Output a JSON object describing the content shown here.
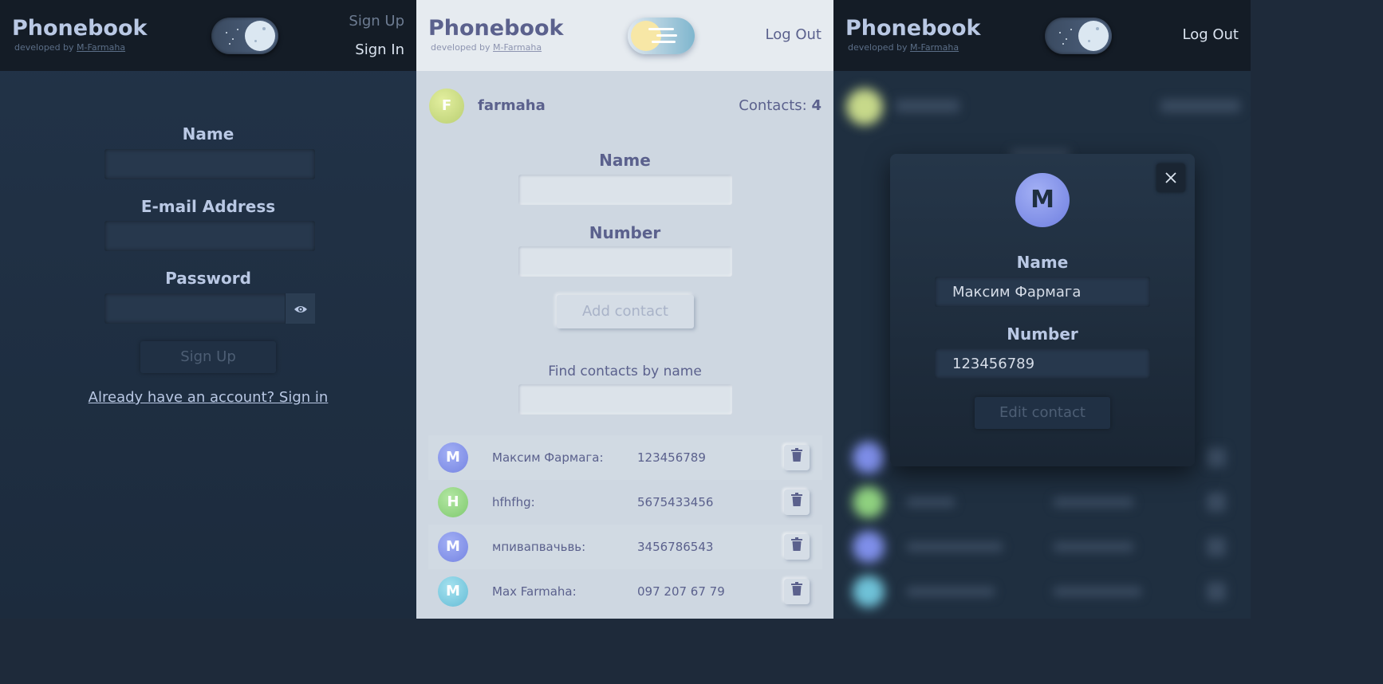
{
  "colors": {
    "dark_bg": "#223348",
    "light_bg": "#ced7e1",
    "text_light": "#b9c8e4",
    "text_dark": "#5b618d",
    "avatar_green": "#c7d98a",
    "avatar_blue": "#7f8fea",
    "avatar_lime": "#8fd17f",
    "avatar_cyan": "#6fc2d8"
  },
  "icons": {
    "eye": "eye-icon",
    "trash": "trash-icon",
    "close": "close-icon",
    "moon": "moon-icon",
    "sun": "sun-icon"
  },
  "signup_screen": {
    "header": {
      "title": "Phonebook",
      "subtitle_prefix": "developed by",
      "subtitle_link": "M-Farmaha",
      "sign_up": "Sign Up",
      "sign_in": "Sign In"
    },
    "form": {
      "name_label": "Name",
      "email_label": "E-mail Address",
      "password_label": "Password",
      "submit": "Sign Up",
      "signin_link": "Already have an account? Sign in"
    }
  },
  "contacts_screen": {
    "header": {
      "title": "Phonebook",
      "subtitle_prefix": "developed by",
      "subtitle_link": "M-Farmaha",
      "log_out": "Log Out"
    },
    "user": {
      "initial": "F",
      "name": "farmaha",
      "contacts_label": "Contacts:",
      "contacts_count": "4"
    },
    "form": {
      "name_label": "Name",
      "number_label": "Number",
      "add_button": "Add contact",
      "find_label": "Find contacts by name"
    },
    "contacts": [
      {
        "initial": "М",
        "name": "Максим Фармага:",
        "number": "123456789",
        "color": "#7f8fea"
      },
      {
        "initial": "H",
        "name": "hfhfhg:",
        "number": "5675433456",
        "color": "#8fd17f"
      },
      {
        "initial": "М",
        "name": "мпивапвачьвь:",
        "number": "3456786543",
        "color": "#7f8fea"
      },
      {
        "initial": "M",
        "name": "Max Farmaha:",
        "number": "097 207 67 79",
        "color": "#6fc2d8"
      }
    ]
  },
  "edit_screen": {
    "header": {
      "title": "Phonebook",
      "subtitle_prefix": "developed by",
      "subtitle_link": "M-Farmaha",
      "log_out": "Log Out"
    },
    "modal": {
      "initial": "M",
      "name_label": "Name",
      "name_value": "Максим Фармага",
      "number_label": "Number",
      "number_value": "123456789",
      "edit_button": "Edit contact"
    }
  }
}
